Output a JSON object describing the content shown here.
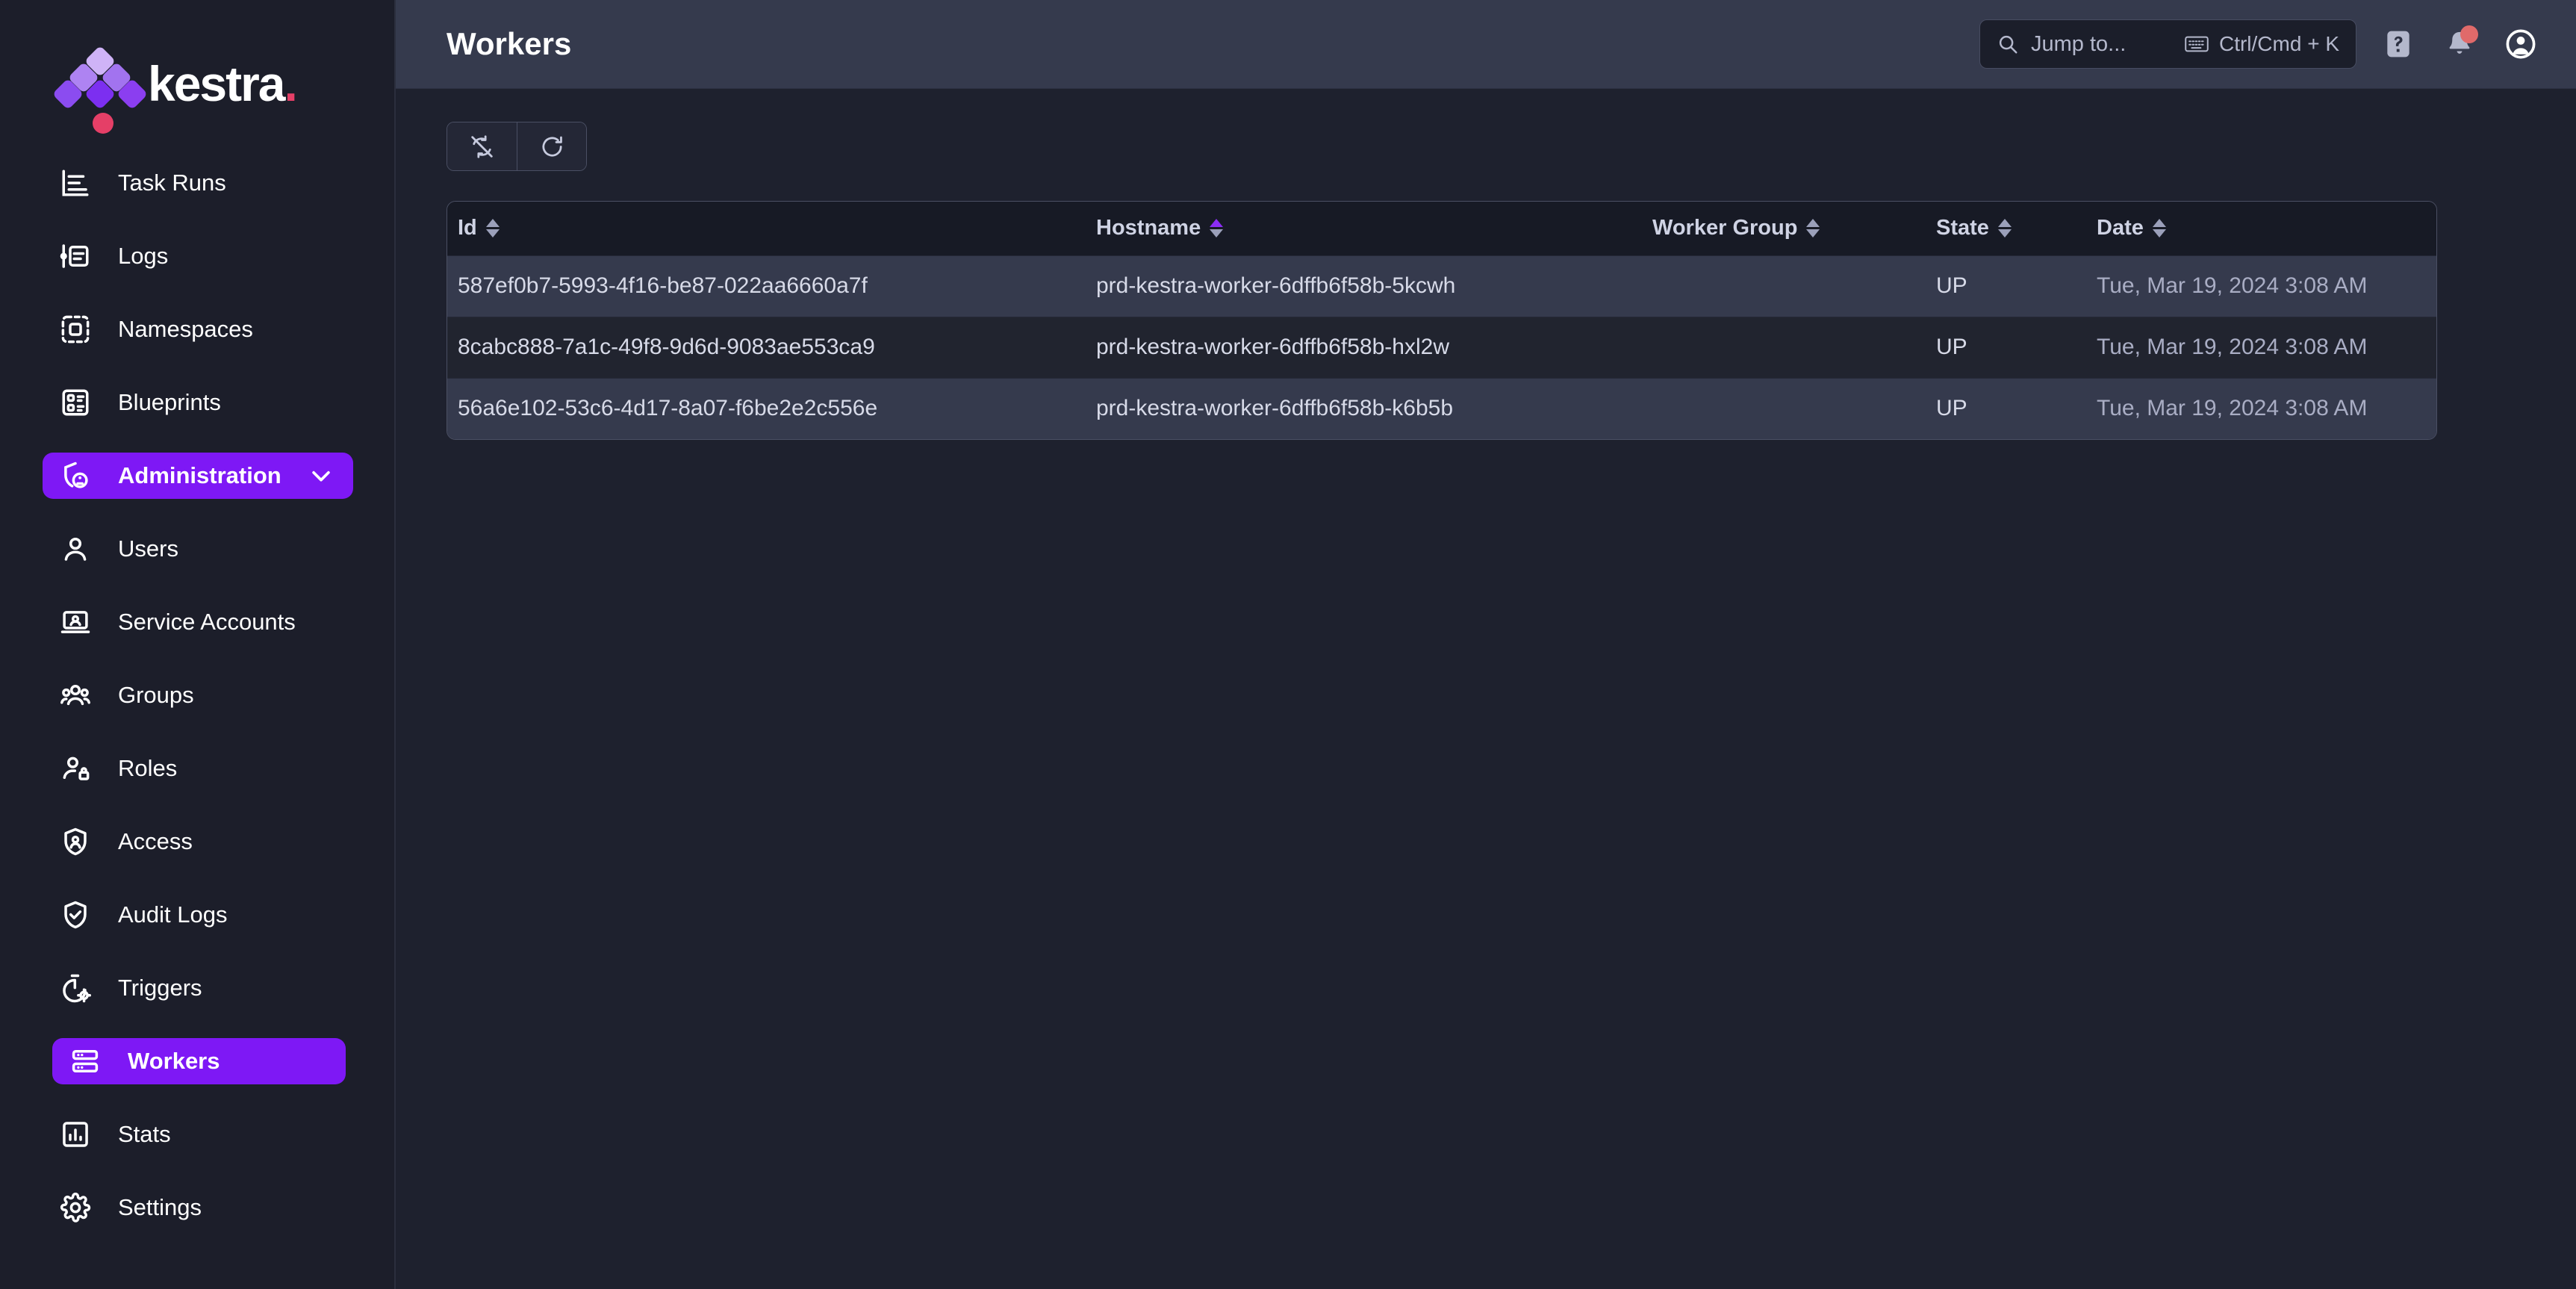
{
  "brand": {
    "name": "kestra",
    "logo_icon": "kestra-diamond-logo",
    "accent_purple": "#7e18f5",
    "accent_pink": "#e53f67"
  },
  "sidebar": {
    "items": [
      {
        "label": "Task Runs",
        "icon": "task-runs-icon",
        "active": false,
        "sub": false
      },
      {
        "label": "Logs",
        "icon": "logs-icon",
        "active": false,
        "sub": false
      },
      {
        "label": "Namespaces",
        "icon": "namespaces-icon",
        "active": false,
        "sub": false
      },
      {
        "label": "Blueprints",
        "icon": "blueprints-icon",
        "active": false,
        "sub": false
      },
      {
        "label": "Administration",
        "icon": "administration-icon",
        "active": true,
        "sub": false,
        "expandable": true,
        "chevron": "chevron-down-icon"
      },
      {
        "label": "Users",
        "icon": "user-icon",
        "active": false,
        "sub": true
      },
      {
        "label": "Service Accounts",
        "icon": "service-account-icon",
        "active": false,
        "sub": true
      },
      {
        "label": "Groups",
        "icon": "groups-icon",
        "active": false,
        "sub": true
      },
      {
        "label": "Roles",
        "icon": "roles-icon",
        "active": false,
        "sub": true
      },
      {
        "label": "Access",
        "icon": "access-shield-icon",
        "active": false,
        "sub": true
      },
      {
        "label": "Audit Logs",
        "icon": "audit-logs-icon",
        "active": false,
        "sub": true
      },
      {
        "label": "Triggers",
        "icon": "triggers-icon",
        "active": false,
        "sub": true
      },
      {
        "label": "Workers",
        "icon": "workers-icon",
        "active": true,
        "sub": true
      },
      {
        "label": "Stats",
        "icon": "stats-icon",
        "active": false,
        "sub": true
      },
      {
        "label": "Settings",
        "icon": "settings-gear-icon",
        "active": false,
        "sub": true
      }
    ]
  },
  "header": {
    "title": "Workers",
    "search": {
      "placeholder": "Jump to...",
      "value": "",
      "icon": "search-icon",
      "keyboard_icon": "keyboard-icon",
      "shortcut": "Ctrl/Cmd + K"
    },
    "help_icon": "help-question-icon",
    "notifications_icon": "bell-icon",
    "notifications_badge": true,
    "account_icon": "user-account-icon"
  },
  "toolbar": {
    "buttons": [
      {
        "name": "auto-refresh-off-button",
        "icon": "sync-disabled-icon"
      },
      {
        "name": "refresh-button",
        "icon": "refresh-icon"
      }
    ]
  },
  "table": {
    "columns": [
      {
        "label": "Id",
        "sortable": true,
        "sorted": "none"
      },
      {
        "label": "Hostname",
        "sortable": true,
        "sorted": "asc"
      },
      {
        "label": "Worker Group",
        "sortable": true,
        "sorted": "none"
      },
      {
        "label": "State",
        "sortable": true,
        "sorted": "none"
      },
      {
        "label": "Date",
        "sortable": true,
        "sorted": "none"
      }
    ],
    "rows": [
      {
        "id": "587ef0b7-5993-4f16-be87-022aa6660a7f",
        "hostname": "prd-kestra-worker-6dffb6f58b-5kcwh",
        "worker_group": "",
        "state": "UP",
        "date": "Tue, Mar 19, 2024 3:08 AM"
      },
      {
        "id": "8cabc888-7a1c-49f8-9d6d-9083ae553ca9",
        "hostname": "prd-kestra-worker-6dffb6f58b-hxl2w",
        "worker_group": "",
        "state": "UP",
        "date": "Tue, Mar 19, 2024 3:08 AM"
      },
      {
        "id": "56a6e102-53c6-4d17-8a07-f6be2e2c556e",
        "hostname": "prd-kestra-worker-6dffb6f58b-k6b5b",
        "worker_group": "",
        "state": "UP",
        "date": "Tue, Mar 19, 2024 3:08 AM"
      }
    ]
  }
}
